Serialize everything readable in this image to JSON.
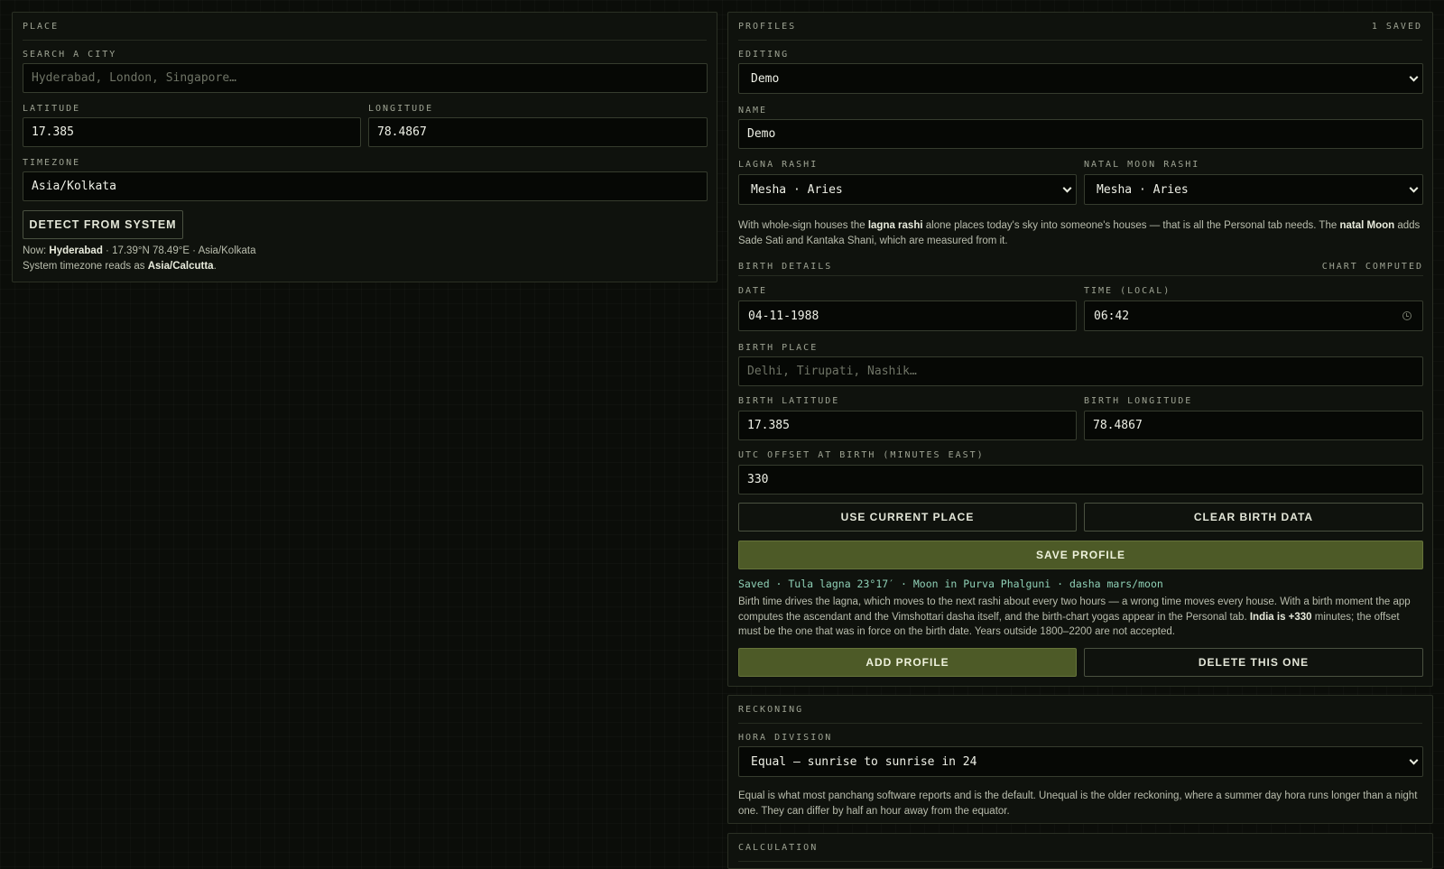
{
  "place": {
    "title": "PLACE",
    "search_label": "SEARCH A CITY",
    "search_placeholder": "Hyderabad, London, Singapore…",
    "search_value": "",
    "latitude_label": "LATITUDE",
    "latitude_value": "17.385",
    "longitude_label": "LONGITUDE",
    "longitude_value": "78.4867",
    "timezone_label": "TIMEZONE",
    "timezone_value": "Asia/Kolkata",
    "detect_button": "DETECT FROM SYSTEM",
    "now_prefix": "Now: ",
    "now_city": "Hyderabad",
    "now_rest": " · 17.39°N 78.49°E · Asia/Kolkata",
    "sys_prefix": "System timezone reads as ",
    "sys_tz": "Asia/Calcutta",
    "sys_suffix": "."
  },
  "profiles": {
    "title": "PROFILES",
    "count": "1 SAVED",
    "editing_label": "EDITING",
    "editing_value": "Demo",
    "name_label": "NAME",
    "name_value": "Demo",
    "lagna_label": "LAGNA RASHI",
    "lagna_value": "Mesha · Aries",
    "moon_label": "NATAL MOON RASHI",
    "moon_value": "Mesha · Aries",
    "note_1a": "With whole-sign houses the ",
    "note_1b": "lagna rashi",
    "note_1c": " alone places today's sky into someone's houses — that is all the Personal tab needs. The ",
    "note_1d": "natal Moon",
    "note_1e": " adds Sade Sati and Kantaka Shani, which are measured from it.",
    "birth_title": "BIRTH DETAILS",
    "birth_status": "CHART COMPUTED",
    "date_label": "DATE",
    "date_value": "04-11-1988",
    "time_label": "TIME (LOCAL)",
    "time_value": "06:42",
    "birthplace_label": "BIRTH PLACE",
    "birthplace_placeholder": "Delhi, Tirupati, Nashik…",
    "birthplace_value": "",
    "blat_label": "BIRTH LATITUDE",
    "blat_value": "17.385",
    "blon_label": "BIRTH LONGITUDE",
    "blon_value": "78.4867",
    "utc_label": "UTC OFFSET AT BIRTH (MINUTES EAST)",
    "utc_value": "330",
    "use_current_button": "USE CURRENT PLACE",
    "clear_button": "CLEAR BIRTH DATA",
    "save_button": "SAVE PROFILE",
    "saved_status": "Saved · Tula lagna 23°17′ · Moon in Purva Phalguni · dasha mars/moon",
    "note_2a": "Birth time drives the lagna, which moves to the next rashi about every two hours — a wrong time moves every house. With a birth moment the app computes the ascendant and the Vimshottari dasha itself, and the birth-chart yogas appear in the Personal tab. ",
    "note_2b": "India is +330",
    "note_2c": " minutes; the offset must be the one that was in force on the birth date. Years outside 1800–2200 are not accepted.",
    "add_button": "ADD PROFILE",
    "delete_button": "DELETE THIS ONE"
  },
  "reckoning": {
    "title": "RECKONING",
    "hora_label": "HORA DIVISION",
    "hora_value": "Equal — sunrise to sunrise in 24",
    "note": "Equal is what most panchang software reports and is the default. Unequal is the older reckoning, where a summer day hora runs longer than a night one. They can differ by half an hour away from the equator."
  },
  "calculation": {
    "title": "CALCULATION"
  },
  "colors": {
    "background": "#0b0d09",
    "panel": "#0f120d",
    "accent": "#4d5a27",
    "status_text": "#8fd0b6"
  }
}
